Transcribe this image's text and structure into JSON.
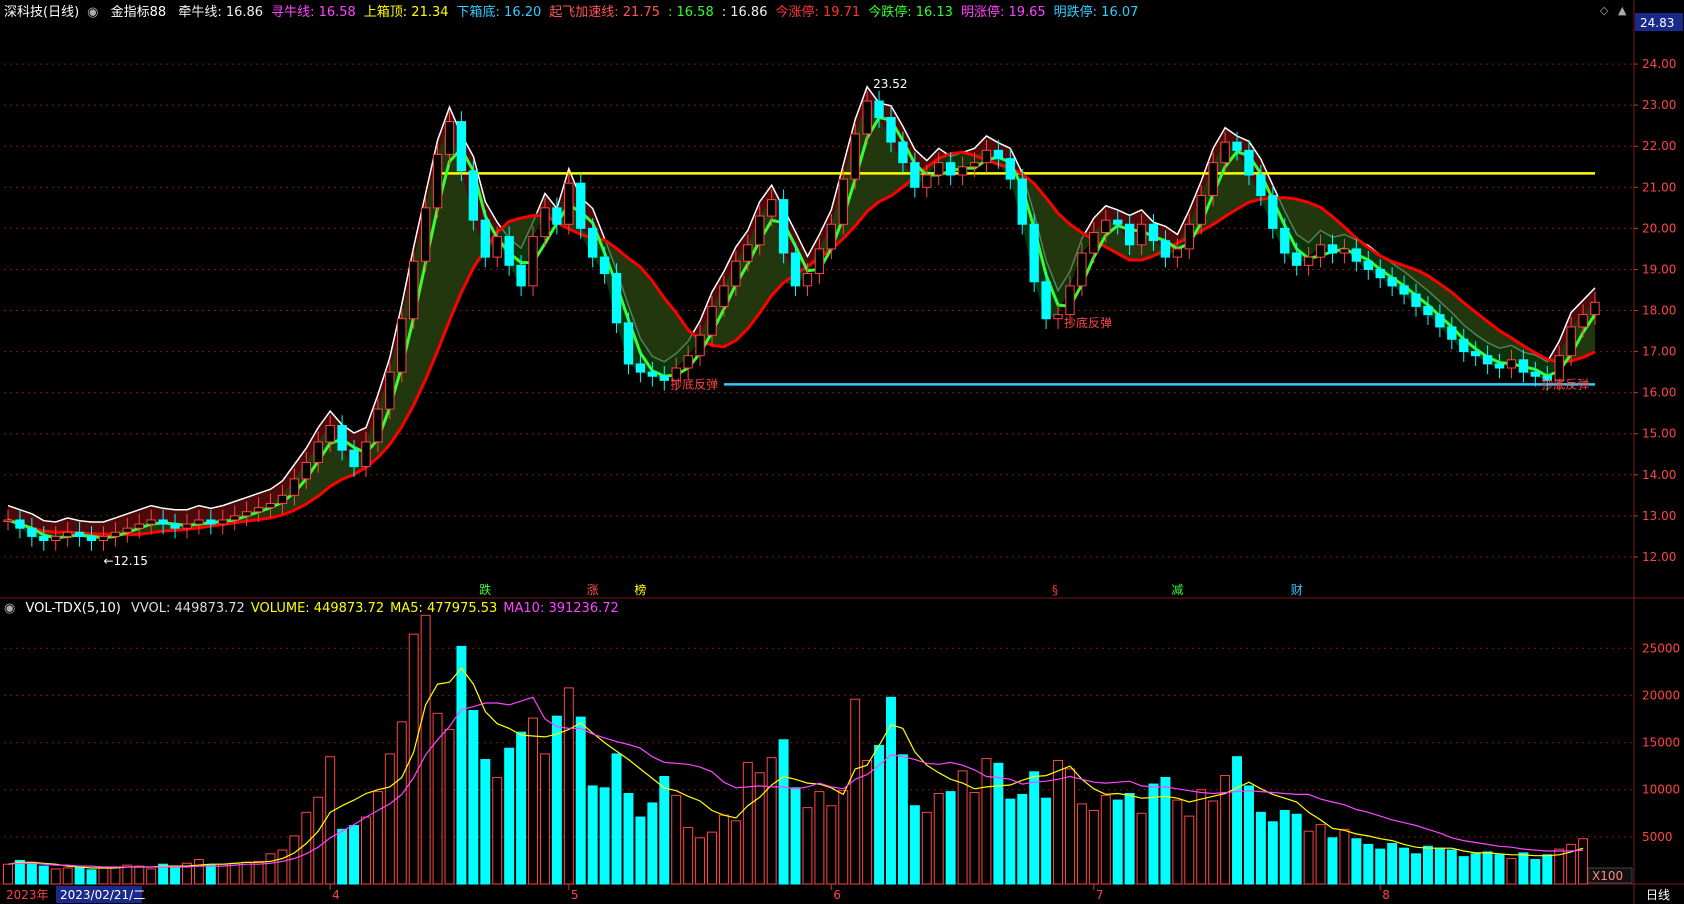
{
  "header": {
    "stock": "深科技(日线)",
    "indicator": "金指标88",
    "items": [
      {
        "label": "牵牛线: 16.86",
        "color": "#f0f0f0"
      },
      {
        "label": "寻牛线: 16.58",
        "color": "#ff44ff"
      },
      {
        "label": "上箱顶: 21.34",
        "color": "#ffff00"
      },
      {
        "label": "下箱底: 16.20",
        "color": "#33ccff"
      },
      {
        "label": "起飞加速线: 21.75",
        "color": "#ff5555"
      },
      {
        "label": ": 16.58",
        "color": "#33ff33"
      },
      {
        "label": ": 16.86",
        "color": "#f0f0f0"
      },
      {
        "label": "今涨停: 19.71",
        "color": "#ff3333"
      },
      {
        "label": "今跌停: 16.13",
        "color": "#33ff33"
      },
      {
        "label": "明涨停: 19.65",
        "color": "#ff44ff"
      },
      {
        "label": "明跌停: 16.07",
        "color": "#33ccff"
      }
    ],
    "current_price_tag": "24.83"
  },
  "volume_header": {
    "name": "VOL-TDX(5,10)",
    "items": [
      {
        "label": "VVOL: 449873.72",
        "color": "#dddddd"
      },
      {
        "label": "VOLUME: 449873.72",
        "color": "#ffff00"
      },
      {
        "label": "MA5: 477975.53",
        "color": "#ffff00"
      },
      {
        "label": "MA10: 391236.72",
        "color": "#ff44ff"
      }
    ],
    "unit_label": "X100"
  },
  "annotations": {
    "low_label": "←12.15",
    "high_label": "23.52",
    "bounce_labels": [
      "抄底反弹",
      "抄底反弹",
      "抄底反弹"
    ],
    "events": [
      {
        "text": "跌",
        "color": "#33ff33"
      },
      {
        "text": "涨",
        "color": "#ff5555"
      },
      {
        "text": "榜",
        "color": "#ffff00"
      },
      {
        "text": "§",
        "color": "#ff3333"
      },
      {
        "text": "减",
        "color": "#33ff33"
      },
      {
        "text": "财",
        "color": "#33ccff"
      }
    ]
  },
  "bottom_axis": {
    "year": "2023年",
    "cursor_date": "2023/02/21/二",
    "months": [
      "4",
      "5",
      "6",
      "7",
      "8"
    ],
    "period": "日线"
  },
  "colors": {
    "up": "#ff4444",
    "down": "#00ffff",
    "grid": "#7a1a1a",
    "ma_white": "#ffffff",
    "box_top": "#ffff00",
    "box_bottom": "#33ccff",
    "ma_red": "#ff0000",
    "ma_green": "#33ff33"
  },
  "chart_data": [
    {
      "type": "candlestick",
      "title": "深科技(日线)",
      "ylim": [
        11.0,
        24.83
      ],
      "yticks": [
        12.0,
        13.0,
        14.0,
        15.0,
        16.0,
        17.0,
        18.0,
        19.0,
        20.0,
        21.0,
        22.0,
        23.0,
        24.0
      ],
      "close": [
        12.9,
        12.7,
        12.5,
        12.4,
        12.5,
        12.6,
        12.5,
        12.4,
        12.5,
        12.6,
        12.7,
        12.8,
        12.9,
        12.8,
        12.7,
        12.8,
        12.9,
        12.8,
        12.9,
        13.0,
        13.1,
        13.2,
        13.3,
        13.5,
        13.9,
        14.3,
        14.8,
        15.2,
        14.6,
        14.2,
        14.8,
        15.6,
        16.5,
        17.8,
        19.2,
        20.5,
        21.8,
        22.6,
        21.4,
        20.2,
        19.3,
        19.8,
        19.1,
        18.6,
        19.8,
        20.5,
        20.1,
        21.1,
        20.0,
        19.3,
        18.9,
        17.7,
        16.7,
        16.5,
        16.4,
        16.3,
        16.6,
        16.9,
        17.4,
        18.1,
        18.6,
        19.2,
        19.6,
        20.3,
        20.7,
        19.4,
        18.6,
        18.9,
        19.5,
        20.1,
        21.2,
        22.3,
        23.1,
        22.7,
        22.1,
        21.6,
        21.0,
        21.3,
        21.6,
        21.3,
        21.5,
        21.6,
        21.9,
        21.7,
        21.2,
        20.1,
        18.7,
        17.8,
        17.9,
        18.6,
        19.4,
        19.9,
        20.2,
        20.1,
        19.6,
        20.1,
        19.7,
        19.3,
        19.5,
        20.1,
        20.8,
        21.6,
        22.1,
        21.9,
        21.3,
        20.8,
        20.0,
        19.4,
        19.1,
        19.3,
        19.6,
        19.4,
        19.5,
        19.2,
        19.0,
        18.8,
        18.6,
        18.4,
        18.1,
        17.9,
        17.6,
        17.3,
        17.0,
        16.9,
        16.7,
        16.6,
        16.8,
        16.5,
        16.4,
        16.3,
        16.9,
        17.6,
        17.9,
        18.2
      ],
      "box_top": 21.34,
      "box_bottom": 16.2,
      "high_label_value": 23.52,
      "low_label_value": 12.15
    },
    {
      "type": "bar",
      "title": "VOL-TDX(5,10)",
      "ylabel": "X100",
      "ylim": [
        0,
        28000
      ],
      "yticks": [
        5000,
        10000,
        15000,
        20000,
        25000
      ],
      "values": [
        2100,
        2500,
        2300,
        1900,
        1600,
        1700,
        1800,
        1500,
        1700,
        1800,
        2000,
        1900,
        1600,
        2100,
        1700,
        2200,
        2600,
        2000,
        2100,
        2200,
        2300,
        2400,
        3200,
        3600,
        5100,
        7600,
        9200,
        13500,
        5800,
        6200,
        7100,
        9800,
        13800,
        17200,
        26500,
        28500,
        18100,
        16400,
        25200,
        18400,
        13200,
        11300,
        14400,
        16100,
        17600,
        13800,
        17800,
        20800,
        17700,
        10400,
        10200,
        13800,
        9600,
        7100,
        8600,
        11400,
        9400,
        6000,
        4900,
        5500,
        7300,
        6700,
        12900,
        11800,
        13400,
        15300,
        10200,
        8100,
        9800,
        8300,
        9900,
        19600,
        13100,
        14700,
        19800,
        13700,
        8300,
        7600,
        9600,
        9800,
        12000,
        9700,
        13300,
        12800,
        9000,
        9500,
        11900,
        9100,
        13100,
        12200,
        8500,
        7800,
        9400,
        8900,
        9600,
        7500,
        10600,
        11300,
        8900,
        7200,
        10000,
        8800,
        11500,
        13500,
        10400,
        7600,
        6600,
        7800,
        7400,
        5600,
        6300,
        4900,
        5800,
        4800,
        4200,
        3700,
        4300,
        3800,
        3200,
        4000,
        3800,
        3600,
        2900,
        3200,
        3400,
        3100,
        2700,
        3300,
        2600,
        3100,
        3700,
        4200,
        4800
      ],
      "ma5": [
        2100,
        2300,
        2300,
        2200,
        2100,
        1900,
        1800,
        1700,
        1700,
        1700,
        1800,
        1800,
        1800,
        1900,
        1900,
        1900,
        2000,
        2100,
        2100,
        2200,
        2300,
        2300,
        2400,
        2700,
        3300,
        4300,
        5600,
        7600,
        8300,
        8900,
        9600,
        10000,
        10300,
        11300,
        14000,
        19000,
        21200,
        21400,
        22900,
        21200,
        18300,
        17000,
        16500,
        15800,
        15700,
        15600,
        15900,
        16400,
        17100,
        16000,
        15000,
        14100,
        13200,
        12200,
        11200,
        10200,
        9900,
        9300,
        8800,
        7800,
        7300,
        7000,
        8300,
        9200,
        10500,
        11400,
        11100,
        10700,
        10600,
        10200,
        9500,
        12200,
        12600,
        14700,
        16900,
        16500,
        14000,
        12600,
        11800,
        11100,
        10700,
        10100,
        10300,
        10400,
        10500,
        11000,
        11400,
        11500,
        12000,
        12500,
        11100,
        10100,
        9500,
        9600,
        9400,
        9100,
        9200,
        9300,
        9100,
        8700,
        9000,
        9300,
        9600,
        10200,
        10800,
        10100,
        9500,
        9100,
        8700,
        7600,
        6800,
        5900,
        5700,
        5300,
        5100,
        4800,
        4600,
        4200,
        3900,
        3800,
        3800,
        3800,
        3500,
        3300,
        3300,
        3200,
        3100,
        3100,
        3000,
        3000,
        3100,
        3400,
        3800
      ],
      "ma10": [
        2100,
        2200,
        2200,
        2100,
        2000,
        2000,
        1900,
        1900,
        1800,
        1800,
        1800,
        1800,
        1800,
        1800,
        1800,
        1800,
        1900,
        1900,
        1900,
        2000,
        2100,
        2100,
        2200,
        2400,
        2700,
        3200,
        3900,
        4900,
        5600,
        6300,
        7100,
        7800,
        8500,
        9500,
        11300,
        13700,
        15300,
        16700,
        18500,
        18800,
        19200,
        19200,
        19000,
        19400,
        19800,
        17500,
        16700,
        16500,
        16500,
        15900,
        15500,
        15100,
        14800,
        14400,
        13500,
        12900,
        12800,
        12700,
        12400,
        11900,
        10800,
        10200,
        10300,
        10400,
        10300,
        10300,
        10100,
        10300,
        10700,
        10300,
        10100,
        11100,
        11600,
        12600,
        13700,
        13500,
        13200,
        12800,
        12700,
        12900,
        12600,
        12100,
        11400,
        11300,
        11100,
        10600,
        10800,
        10900,
        11100,
        11400,
        11100,
        10800,
        10700,
        10800,
        10900,
        10400,
        10300,
        10300,
        10100,
        9900,
        9700,
        9600,
        9700,
        9800,
        9900,
        9800,
        9700,
        9600,
        9500,
        9500,
        9000,
        8700,
        8400,
        7900,
        7600,
        7200,
        6800,
        6500,
        6200,
        5800,
        5400,
        4900,
        4600,
        4400,
        4200,
        4000,
        3900,
        3700,
        3600,
        3500,
        3500,
        3500,
        3600
      ]
    }
  ]
}
